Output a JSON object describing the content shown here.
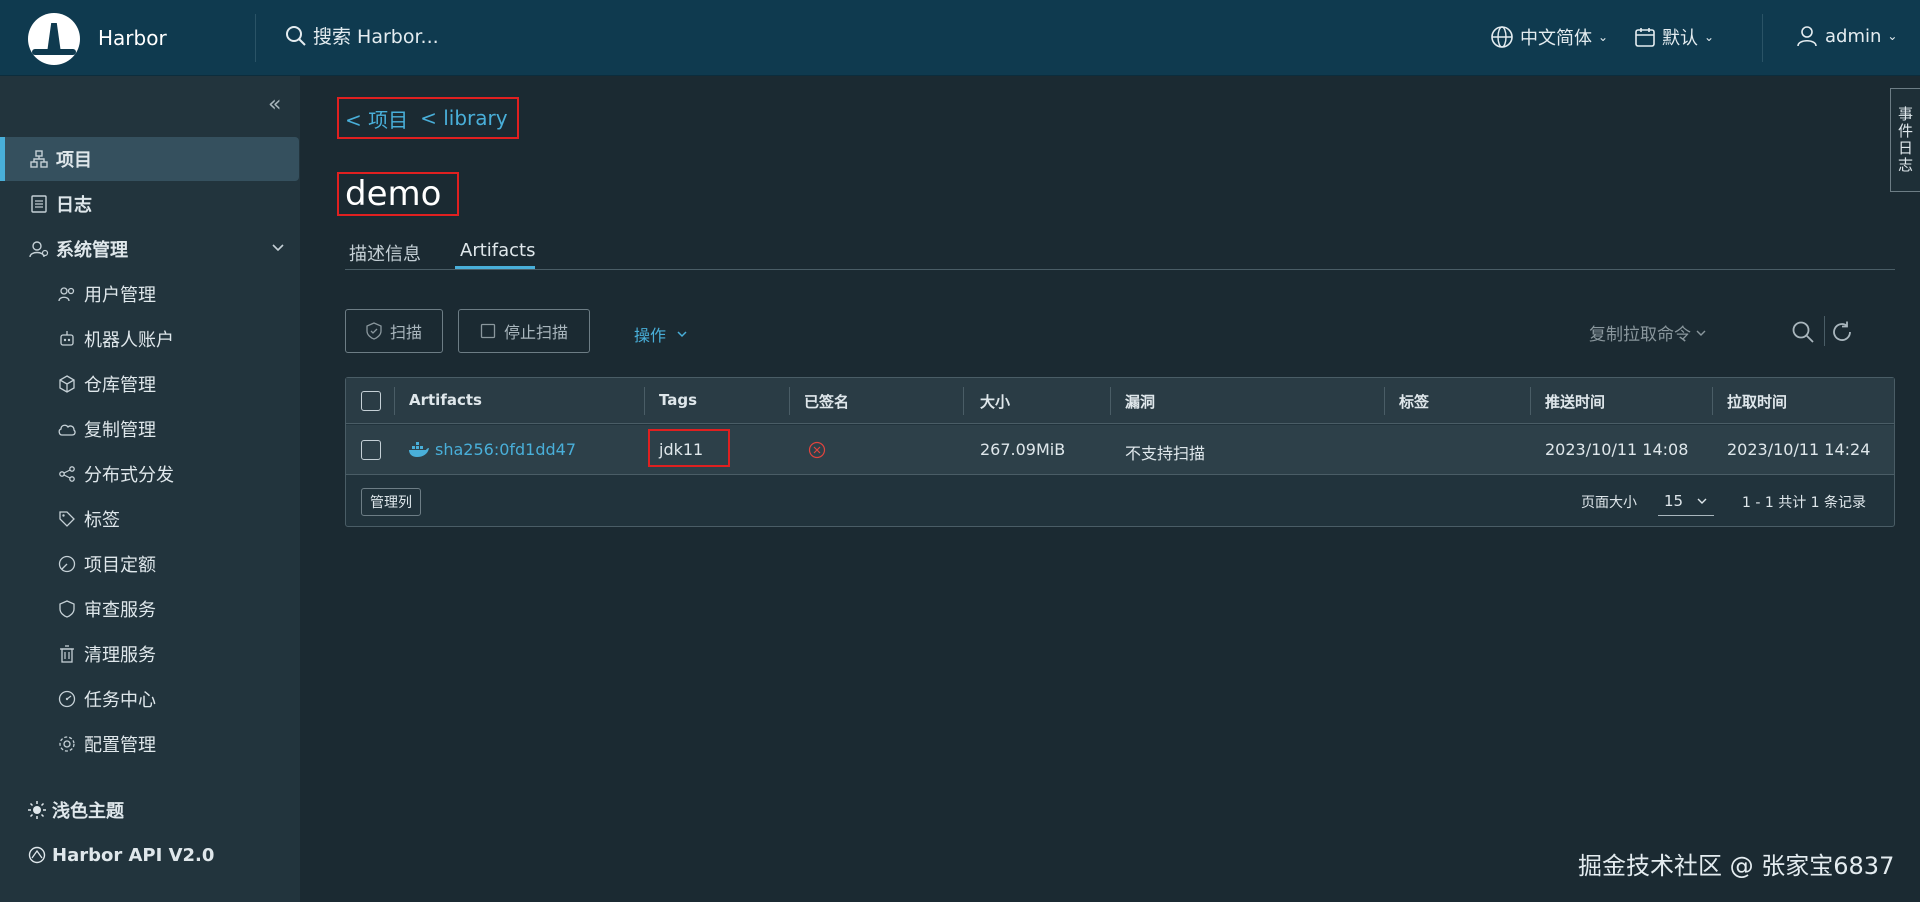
{
  "header": {
    "brand": "Harbor",
    "search_placeholder": "搜索 Harbor...",
    "language": "中文简体",
    "theme_date": "默认",
    "user": "admin"
  },
  "sidebar": {
    "items": [
      {
        "label": "项目",
        "icon": "projects-icon",
        "active": true
      },
      {
        "label": "日志",
        "icon": "logs-icon"
      },
      {
        "label": "系统管理",
        "icon": "admin-icon"
      }
    ],
    "sub_items": [
      {
        "label": "用户管理",
        "icon": "users-icon"
      },
      {
        "label": "机器人账户",
        "icon": "robot-icon"
      },
      {
        "label": "仓库管理",
        "icon": "registry-icon"
      },
      {
        "label": "复制管理",
        "icon": "replication-icon"
      },
      {
        "label": "分布式分发",
        "icon": "distribution-icon"
      },
      {
        "label": "标签",
        "icon": "label-icon"
      },
      {
        "label": "项目定额",
        "icon": "quota-icon"
      },
      {
        "label": "审查服务",
        "icon": "shield-icon"
      },
      {
        "label": "清理服务",
        "icon": "trash-icon"
      },
      {
        "label": "任务中心",
        "icon": "dashboard-icon"
      },
      {
        "label": "配置管理",
        "icon": "gear-icon"
      }
    ],
    "theme": "浅色主题",
    "api": "Harbor API V2.0"
  },
  "event_tab": "事件日志",
  "breadcrumb": {
    "project": "< 项目",
    "repo": "< library"
  },
  "repo_title": "demo",
  "tabs": [
    {
      "label": "描述信息"
    },
    {
      "label": "Artifacts",
      "active": true
    }
  ],
  "toolbar": {
    "scan": "扫描",
    "stop_scan": "停止扫描",
    "actions": "操作",
    "copy_pull": "复制拉取命令"
  },
  "table": {
    "columns": [
      "Artifacts",
      "Tags",
      "已签名",
      "大小",
      "漏洞",
      "标签",
      "推送时间",
      "拉取时间"
    ],
    "rows": [
      {
        "artifact": "sha256:0fd1dd47",
        "tag": "jdk11",
        "size": "267.09MiB",
        "vuln": "不支持扫描",
        "labels": "",
        "push_time": "2023/10/11 14:08",
        "pull_time": "2023/10/11 14:24"
      }
    ],
    "manage_columns": "管理列",
    "page_size_label": "页面大小",
    "page_size": "15",
    "page_info": "1 - 1 共计 1 条记录"
  },
  "watermark": "掘金技术社区 @ 张家宝6837",
  "colors": {
    "header_bg": "#0f3a4f",
    "sidebar_bg": "#22343d",
    "main_bg": "#1b2a32",
    "accent": "#49afd9",
    "highlight_box": "#e02020"
  }
}
